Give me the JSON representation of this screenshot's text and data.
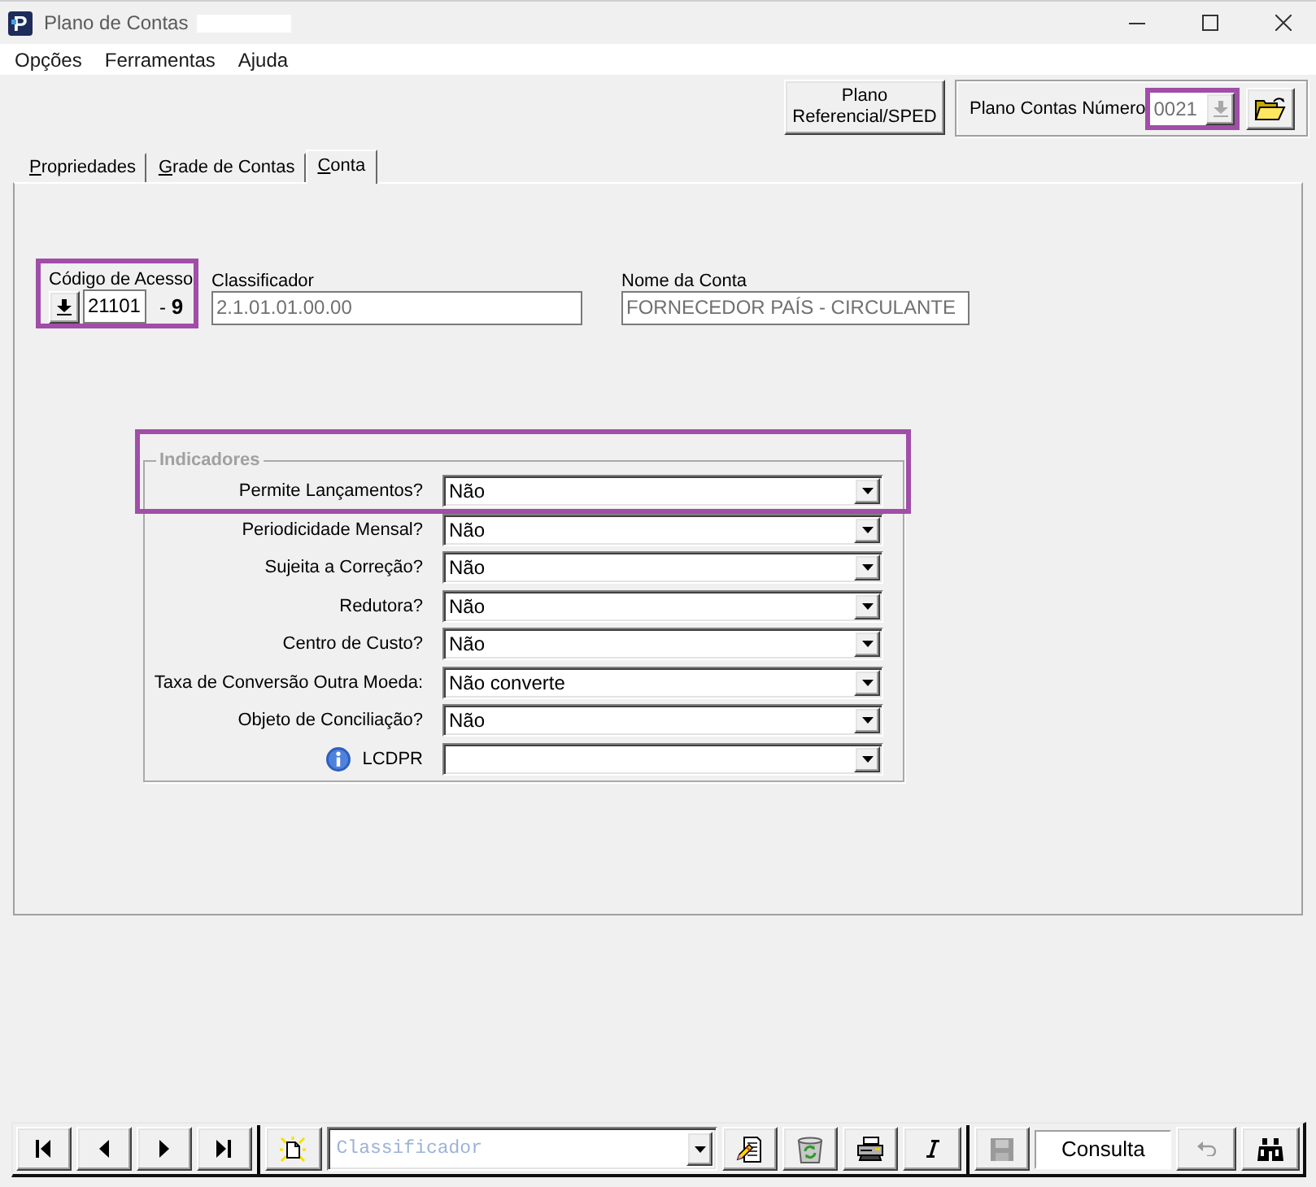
{
  "window": {
    "logo": "P",
    "title": "Plano de Contas",
    "title_suffix_hidden": true
  },
  "menu": [
    {
      "label": "Opções"
    },
    {
      "label": "Ferramentas"
    },
    {
      "label": "Ajuda"
    }
  ],
  "header": {
    "sped_button": {
      "lines": [
        "Plano",
        "Referencial/SPED"
      ]
    },
    "plan_number": {
      "label": "Plano Contas Número",
      "value": "0021",
      "disabled": true,
      "highlighted": true
    }
  },
  "tabs": [
    {
      "label": "Propriedades",
      "selected": false
    },
    {
      "label": "Grade de Contas",
      "selected": false
    },
    {
      "label": "Conta",
      "selected": true
    }
  ],
  "account": {
    "code": {
      "label": "Código de Acesso",
      "value": "21101",
      "check_digit": "- **9**",
      "highlighted": true
    },
    "classifier": {
      "label": "Classificador",
      "value": "2.1.01.01.00.00",
      "disabled": true
    },
    "name": {
      "label": "Nome da Conta",
      "value": "FORNECEDOR PAÍS - CIRCULANTE",
      "disabled": true
    }
  },
  "indicators": {
    "title": "Indicadores",
    "rows": [
      {
        "label": "Permite Lançamentos?",
        "value": "Não",
        "info": false,
        "highlighted": true
      },
      {
        "label": "Periodicidade Mensal?",
        "value": "Não",
        "info": false,
        "highlighted": false
      },
      {
        "label": "Sujeita a Correção?",
        "value": "Não",
        "info": false,
        "highlighted": false
      },
      {
        "label": "Redutora?",
        "value": "Não",
        "info": false,
        "highlighted": false
      },
      {
        "label": "Centro de Custo?",
        "value": "Não",
        "info": false,
        "highlighted": false
      },
      {
        "label": "Taxa de Conversão Outra Moeda:",
        "value": "Não converte",
        "info": false,
        "highlighted": false
      },
      {
        "label": "Objeto de Conciliação?",
        "value": "Não",
        "info": false,
        "highlighted": false
      },
      {
        "label": "LCDPR",
        "info": true,
        "highlighted": false
      }
    ]
  },
  "bottom_toolbar": {
    "items": [
      {
        "kind": "first",
        "disabled": false
      },
      {
        "kind": "previous",
        "disabled": false
      },
      {
        "kind": "next",
        "disabled": false
      },
      {
        "kind": "last",
        "disabled": false
      },
      {
        "kind": "separator"
      },
      {
        "kind": "new",
        "disabled": false
      },
      {
        "kind": "search",
        "placeholder": "Classificador"
      },
      {
        "kind": "edit",
        "disabled": false
      },
      {
        "kind": "delete",
        "disabled": false
      },
      {
        "kind": "print",
        "disabled": false
      },
      {
        "kind": "italic",
        "disabled": false
      },
      {
        "kind": "separator"
      },
      {
        "kind": "save",
        "disabled": true
      },
      {
        "kind": "mode",
        "value": "Consulta"
      },
      {
        "kind": "undo",
        "disabled": true
      },
      {
        "kind": "find",
        "disabled": false
      }
    ]
  }
}
